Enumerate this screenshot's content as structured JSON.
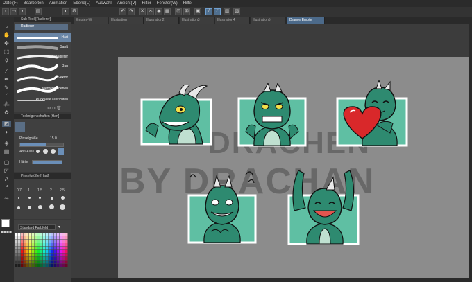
{
  "menu": [
    "Datei(F)",
    "Bearbeiten",
    "Animation",
    "Ebene(L)",
    "Auswahl",
    "Ansicht(V)",
    "Filter",
    "Fenster(W)",
    "Hilfe"
  ],
  "subtool": {
    "header": "Sub-Tool [Radierer]",
    "group": "Radierer",
    "brushes": [
      {
        "label": "Hart"
      },
      {
        "label": "Sanft"
      },
      {
        "label": "Knetradierer"
      },
      {
        "label": "Rau"
      },
      {
        "label": "Vektor"
      },
      {
        "label": "Mehrere Ebenen"
      },
      {
        "label": "Rückseite ausrichten"
      }
    ]
  },
  "tool_property": {
    "header": "Toolmigenschaften [Hart]",
    "size_label": "Pinselgröße",
    "size_value": "15.0",
    "aa_label": "Anti-Alias",
    "hardness_label": "Härte"
  },
  "brush_size": {
    "header": "Pinselgröße [Hart]",
    "values": [
      "0.7",
      "1",
      "1.5",
      "2",
      "2.5"
    ]
  },
  "color_set": {
    "selected": "Standard Farbfeld"
  },
  "tabs": [
    "Emotes-W",
    "Illustration",
    "Illustration2",
    "Illustration3",
    "Illustration4",
    "Illustration5",
    "Dragon Emote"
  ],
  "watermark": {
    "line1": "DRACHEN",
    "line2": "BY DRACHAN"
  },
  "colors": {
    "accent": "#4c6a8a",
    "canvas": "#8c8c8c",
    "dragon": "#2e8a70",
    "dragon_dark": "#1d5c4a",
    "belly": "#bfe0d0",
    "heart": "#d9282a"
  },
  "tools": [
    "zoom-icon",
    "hand-icon",
    "move-icon",
    "selection-icon",
    "lasso-icon",
    "eyedropper-icon",
    "pen-icon",
    "pencil-icon",
    "brush-icon",
    "airbrush-icon",
    "decoration-icon",
    "eraser-icon",
    "blend-icon",
    "fill-icon",
    "gradient-icon",
    "figure-icon",
    "ruler-icon",
    "text-icon",
    "balloon-icon",
    "correct-line-icon"
  ]
}
